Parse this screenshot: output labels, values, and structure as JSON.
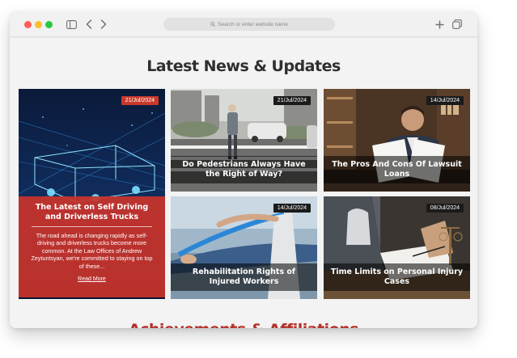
{
  "browser": {
    "url_placeholder": "Search or enter website name"
  },
  "news_section": {
    "title": "Latest News & Updates",
    "cards": [
      {
        "date": "21/Jul/2024",
        "title": "The Latest on Self Driving and Driverless Trucks",
        "excerpt": "The road ahead is changing rapidly as self-driving and driverless trucks become more common. At the Law Offices of Andrew Zeytuntsyan, we're committed to staying on top of these...",
        "read_more": "Read More"
      },
      {
        "date": "21/Jul/2024",
        "title": "Do Pedestrians Always Have the Right of Way?"
      },
      {
        "date": "14/Jul/2024",
        "title": "The Pros And Cons Of Lawsuit Loans"
      },
      {
        "date": "14/Jul/2024",
        "title": "Rehabilitation Rights of Injured Workers"
      },
      {
        "date": "08/Jul/2024",
        "title": "Time Limits on Personal Injury Cases"
      }
    ]
  },
  "achievements_section": {
    "title": "Achievements & Affiliations"
  },
  "colors": {
    "accent_red": "#c8392b",
    "heading_dark": "#2f2f2f",
    "badge_dark": "#1b1b1b"
  }
}
